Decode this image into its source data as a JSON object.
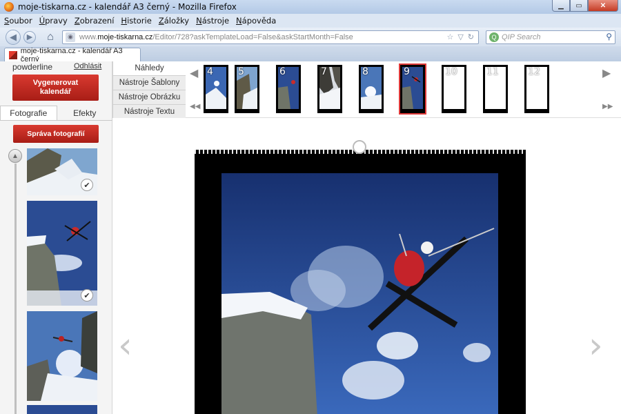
{
  "window": {
    "title": "moje-tiskarna.cz - kalendář A3 černý - Mozilla Firefox"
  },
  "menu": [
    "Soubor",
    "Úpravy",
    "Zobrazení",
    "Historie",
    "Záložky",
    "Nástroje",
    "Nápověda"
  ],
  "nav": {
    "url_prefix": "www.",
    "url_host": "moje-tiskarna.cz",
    "url_path": "/Editor/728?askTemplateLoad=False&askStartMonth=False",
    "search_placeholder": "QIP Search"
  },
  "tab": {
    "title": "moje-tiskarna.cz - kalendář A3 černý"
  },
  "left_panel": {
    "username": "powderline",
    "logout": "Odhlásit",
    "generate_button": "Vygenerovat kalendář",
    "tabs": [
      "Fotografie",
      "Efekty"
    ],
    "manage_button": "Správa fotografií",
    "photos": [
      {
        "checked": true
      },
      {
        "checked": true
      },
      {
        "checked": false
      },
      {
        "checked": false
      }
    ]
  },
  "tool_tabs": [
    "Náhledy",
    "Nástroje Šablony",
    "Nástroje Obrázku",
    "Nástroje Textu"
  ],
  "months": [
    {
      "label": "4",
      "has_photo": true
    },
    {
      "label": "5",
      "has_photo": true
    },
    {
      "label": "6",
      "has_photo": true
    },
    {
      "label": "7",
      "has_photo": true
    },
    {
      "label": "8",
      "has_photo": true
    },
    {
      "label": "9",
      "has_photo": true,
      "selected": true
    },
    {
      "label": "10",
      "has_photo": false
    },
    {
      "label": "11",
      "has_photo": false
    },
    {
      "label": "12",
      "has_photo": false
    }
  ],
  "colors": {
    "brand_red": "#c4271f",
    "selection": "#e03a3a"
  },
  "icons": {
    "prev_arrow": "‹",
    "next_arrow": "›",
    "first": "◀◀",
    "last": "▶▶",
    "back": "◀",
    "forward": "▶",
    "check": "✔"
  }
}
